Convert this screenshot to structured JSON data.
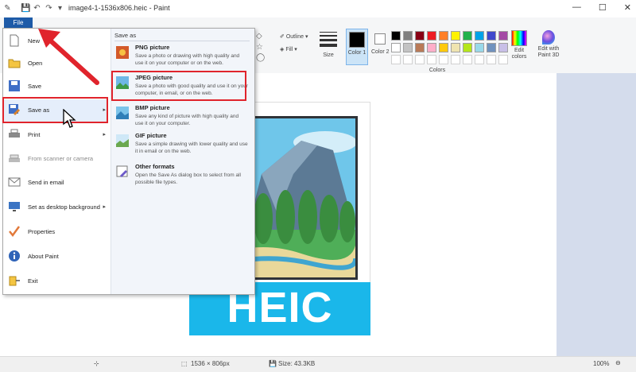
{
  "window": {
    "title": "image4-1-1536x806.heic - Paint",
    "quick_access": [
      "save-icon",
      "undo-icon",
      "redo-icon",
      "customize-icon"
    ]
  },
  "ribbon": {
    "file_tab": "File",
    "outline_label": "Outline",
    "fill_label": "Fill",
    "size_label": "Size",
    "color1_label": "Color 1",
    "color2_label": "Color 2",
    "colors_group": "Colors",
    "edit_colors": "Edit colors",
    "edit_paint3d": "Edit with Paint 3D",
    "palette_row1": [
      "#000000",
      "#7f7f7f",
      "#880015",
      "#ed1c24",
      "#ff7f27",
      "#fff200",
      "#22b14c",
      "#00a2e8",
      "#3f48cc",
      "#a349a4"
    ],
    "palette_row2": [
      "#ffffff",
      "#c3c3c3",
      "#b97a57",
      "#ffaec9",
      "#ffc90e",
      "#efe4b0",
      "#b5e61d",
      "#99d9ea",
      "#7092be",
      "#c8bfe7"
    ],
    "palette_row3": [
      "#ffffff",
      "#ffffff",
      "#ffffff",
      "#ffffff",
      "#ffffff",
      "#ffffff",
      "#ffffff",
      "#ffffff",
      "#ffffff",
      "#ffffff"
    ]
  },
  "file_menu": {
    "items": [
      {
        "label": "New",
        "icon": "new-file-icon"
      },
      {
        "label": "Open",
        "icon": "open-folder-icon"
      },
      {
        "label": "Save",
        "icon": "save-icon"
      },
      {
        "label": "Save as",
        "icon": "save-as-icon",
        "has_submenu": true
      },
      {
        "label": "Print",
        "icon": "printer-icon",
        "has_submenu": true
      },
      {
        "label": "From scanner or camera",
        "icon": "scanner-icon"
      },
      {
        "label": "Send in email",
        "icon": "email-icon"
      },
      {
        "label": "Set as desktop background",
        "icon": "desktop-icon",
        "has_submenu": true
      },
      {
        "label": "Properties",
        "icon": "checkmark-icon"
      },
      {
        "label": "About Paint",
        "icon": "info-icon"
      },
      {
        "label": "Exit",
        "icon": "exit-icon"
      }
    ],
    "submenu_title": "Save as",
    "submenu": [
      {
        "title": "PNG picture",
        "desc": "Save a photo or drawing with high quality and use it on your computer or on the web."
      },
      {
        "title": "JPEG picture",
        "desc": "Save a photo with good quality and use it on your computer, in email, or on the web."
      },
      {
        "title": "BMP picture",
        "desc": "Save any kind of picture with high quality and use it on your computer."
      },
      {
        "title": "GIF picture",
        "desc": "Save a simple drawing with lower quality and use it in email or on the web."
      },
      {
        "title": "Other formats",
        "desc": "Open the Save As dialog box to select from all possible file types."
      }
    ]
  },
  "canvas": {
    "heic_text": "HEIC"
  },
  "status": {
    "dimensions": "1536 × 806px",
    "size": "Size: 43.3KB",
    "zoom": "100%"
  },
  "colors": {
    "accent": "#1e5ba8",
    "highlight": "#e0242c",
    "heic_band": "#1ab7ea"
  }
}
